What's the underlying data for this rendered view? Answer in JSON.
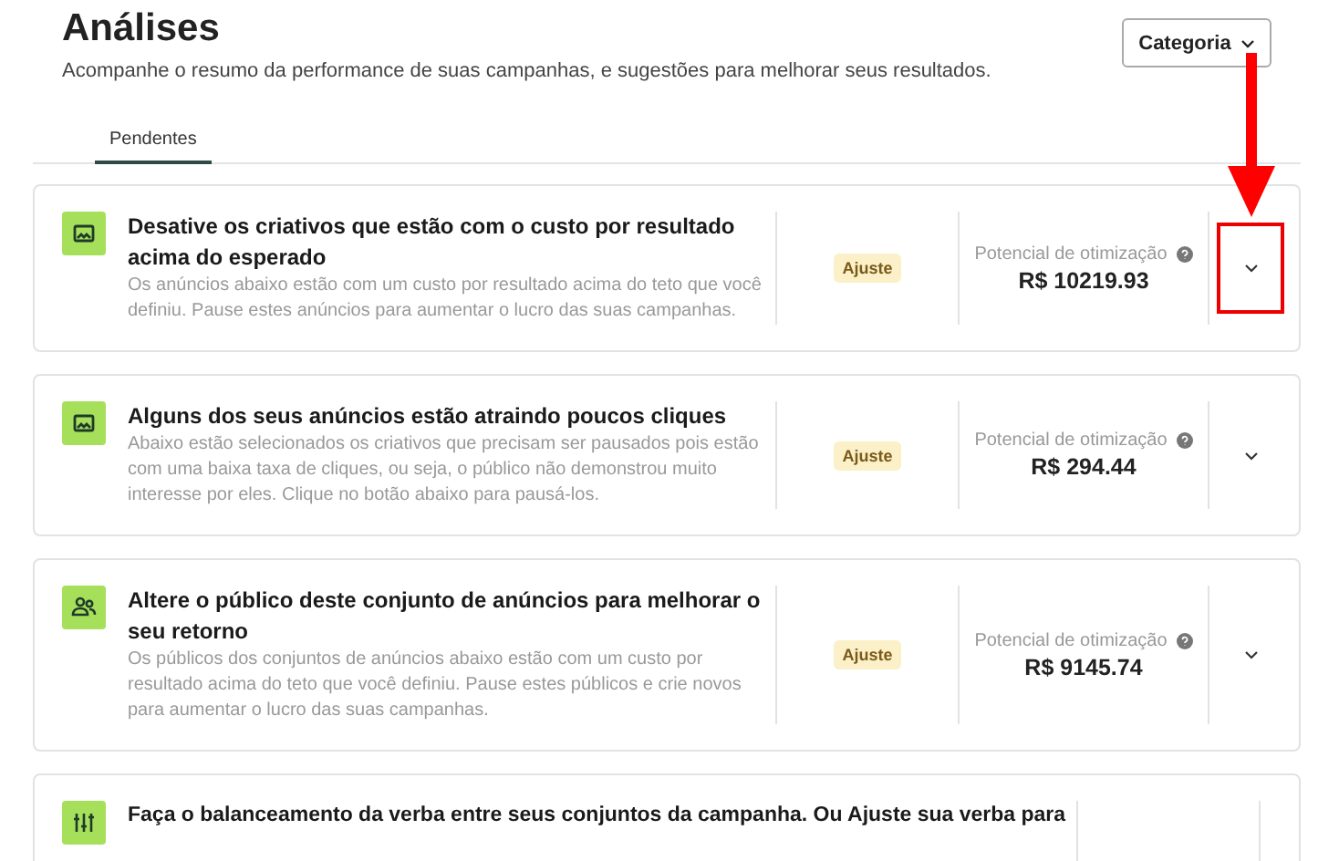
{
  "header": {
    "title": "Análises",
    "subtitle": "Acompanhe o resumo da performance de suas campanhas, e sugestões para melhorar seus resultados.",
    "category_button": "Categoria"
  },
  "tabs": [
    {
      "label": "Pendentes",
      "selected": true
    }
  ],
  "cards": [
    {
      "kind": "image",
      "title": "Desative os criativos que estão com o custo por resultado acima do esperado",
      "description": "Os anúncios abaixo estão com um custo por resultado acima do teto que você definiu. Pause estes anúncios para aumentar o lucro das suas campanhas.",
      "badge": "Ajuste",
      "potential_label": "Potencial de otimização",
      "potential_value": "R$ 10219.93",
      "highlighted": true
    },
    {
      "kind": "image",
      "title": "Alguns dos seus anúncios estão atraindo poucos cliques",
      "description": "Abaixo estão selecionados os criativos que precisam ser pausados pois estão com uma baixa taxa de cliques, ou seja, o público não demonstrou muito interesse por eles. Clique no botão abaixo para pausá-los.",
      "badge": "Ajuste",
      "potential_label": "Potencial de otimização",
      "potential_value": "R$ 294.44",
      "highlighted": false
    },
    {
      "kind": "audience",
      "title": "Altere o público deste conjunto de anúncios para melhorar o seu retorno",
      "description": "Os públicos dos conjuntos de anúncios abaixo estão com um custo por resultado acima do teto que você definiu. Pause estes públicos e crie novos para aumentar o lucro das suas campanhas.",
      "badge": "Ajuste",
      "potential_label": "Potencial de otimização",
      "potential_value": "R$ 9145.74",
      "highlighted": false
    },
    {
      "kind": "sliders",
      "title": "Faça o balanceamento da verba entre seus conjuntos da campanha. Ou Ajuste sua verba para",
      "highlighted": false
    }
  ]
}
